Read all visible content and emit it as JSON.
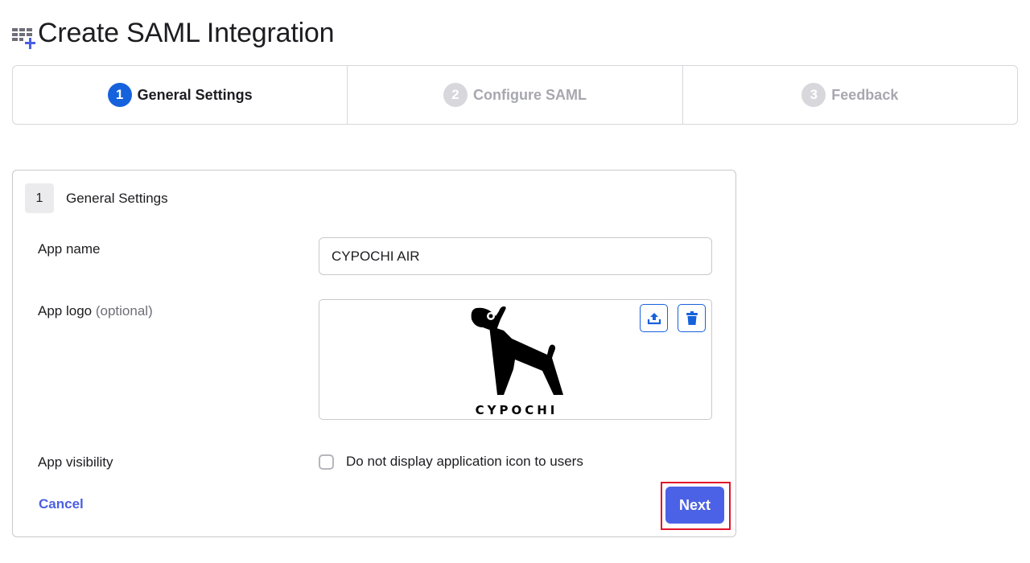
{
  "header": {
    "title": "Create SAML Integration",
    "icon": "add-app-grid-icon"
  },
  "stepper": {
    "steps": [
      {
        "number": "1",
        "label": "General Settings",
        "state": "active"
      },
      {
        "number": "2",
        "label": "Configure SAML",
        "state": "inactive"
      },
      {
        "number": "3",
        "label": "Feedback",
        "state": "inactive"
      }
    ]
  },
  "card": {
    "step_number": "1",
    "title": "General Settings",
    "fields": {
      "app_name": {
        "label": "App name",
        "value": "CYPOCHI AIR"
      },
      "app_logo": {
        "label": "App logo",
        "optional": "(optional)",
        "logo_text": "CYPOCHI",
        "upload_icon": "upload-icon",
        "delete_icon": "trash-icon"
      },
      "app_visibility": {
        "label": "App visibility",
        "checkbox_label": "Do not display application icon to users",
        "checked": false
      }
    },
    "actions": {
      "cancel": "Cancel",
      "next": "Next"
    }
  },
  "colors": {
    "accent": "#4b62e6",
    "step_active": "#1662dd",
    "highlight": "#e3142b"
  }
}
